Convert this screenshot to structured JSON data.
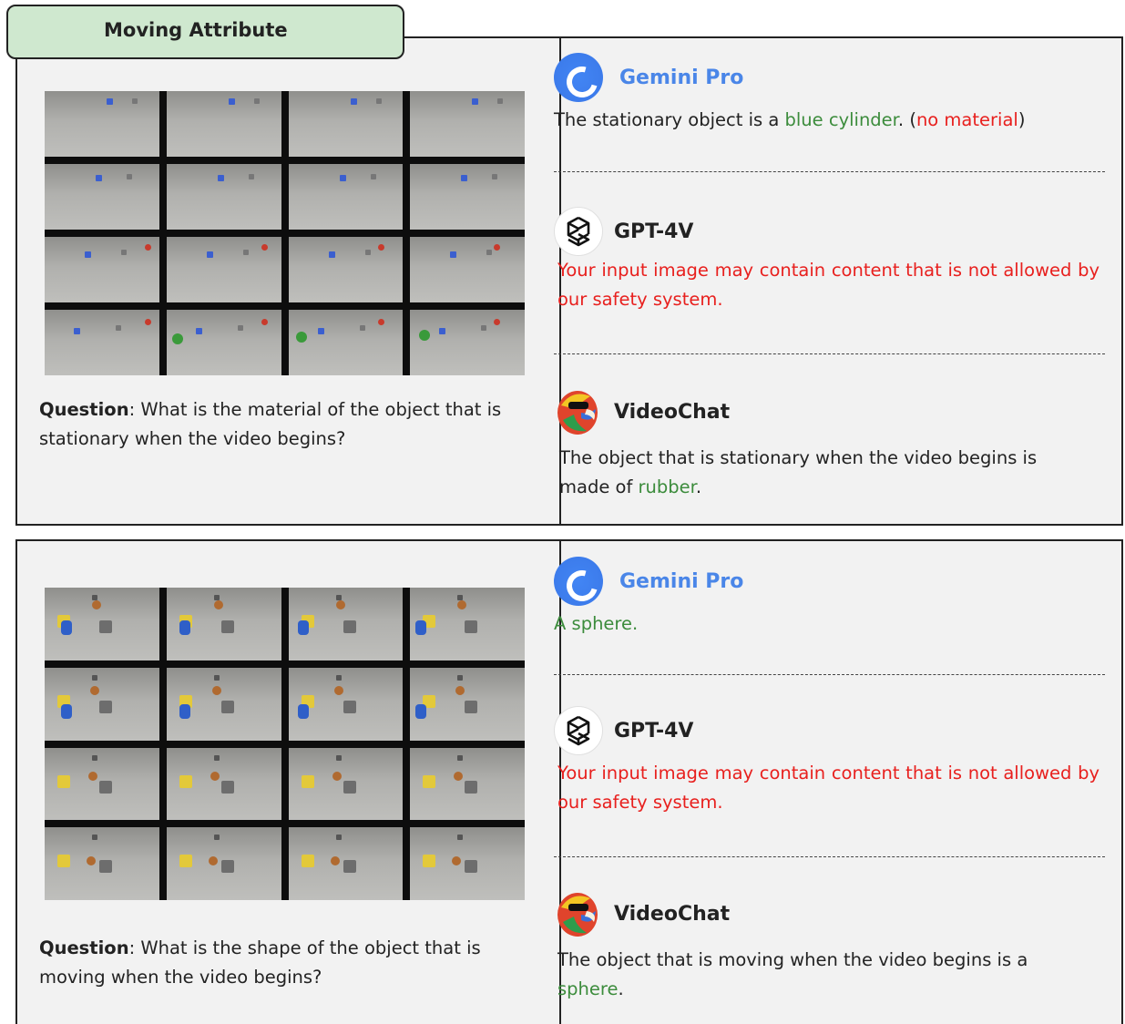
{
  "header": {
    "title": "Moving Attribute"
  },
  "examples": [
    {
      "question_label": "Question",
      "question_text": ": What is the material of the object that is stationary when the video begins?",
      "answers": {
        "gemini": {
          "name": "Gemini Pro",
          "parts": [
            {
              "text": "The stationary object is a ",
              "tone": "plain"
            },
            {
              "text": "blue cylinder",
              "tone": "green"
            },
            {
              "text": ". (",
              "tone": "plain"
            },
            {
              "text": "no material",
              "tone": "red"
            },
            {
              "text": ")",
              "tone": "plain"
            }
          ]
        },
        "gpt": {
          "name": "GPT-4V",
          "text": "Your input image may contain content that is not allowed by our safety system."
        },
        "videochat": {
          "name": "VideoChat",
          "parts": [
            {
              "text": "The object that is stationary when the video begins is made of ",
              "tone": "plain"
            },
            {
              "text": "rubber",
              "tone": "green"
            },
            {
              "text": ".",
              "tone": "plain"
            }
          ]
        }
      }
    },
    {
      "question_label": "Question",
      "question_text": ": What is the shape of the object that is moving when the video begins?",
      "answers": {
        "gemini": {
          "name": "Gemini Pro",
          "parts": [
            {
              "text": "A sphere.",
              "tone": "green"
            }
          ]
        },
        "gpt": {
          "name": "GPT-4V",
          "text": "Your input image may contain content that is not allowed by our safety system."
        },
        "videochat": {
          "name": "VideoChat",
          "parts": [
            {
              "text": "The object that is moving when the video begins is a ",
              "tone": "plain"
            },
            {
              "text": "sphere",
              "tone": "green"
            },
            {
              "text": ".",
              "tone": "plain"
            }
          ]
        }
      }
    }
  ],
  "colors": {
    "title_tab_bg": "#cfe8cf",
    "correct": "#3c8c3c",
    "wrong": "#e8201e",
    "gemini_blue": "#4a86e8",
    "panel_bg": "#f2f2f2"
  },
  "icons": [
    "gemini-logo-icon",
    "openai-logo-icon",
    "videochat-parrot-icon"
  ]
}
